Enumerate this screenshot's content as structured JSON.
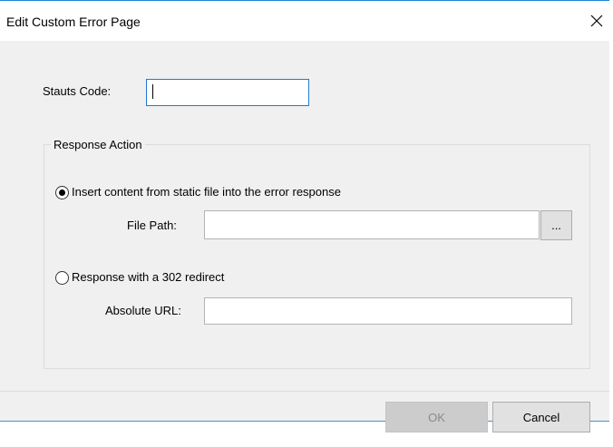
{
  "dialog": {
    "title": "Edit Custom Error Page",
    "close_icon": "close-icon"
  },
  "status_code": {
    "label": "Stauts Code:",
    "value": ""
  },
  "response_action": {
    "legend": "Response Action",
    "option_static": {
      "label": "Insert content from static file into the error response",
      "selected": true
    },
    "file_path": {
      "label": "File Path:",
      "value": "",
      "browse_label": "..."
    },
    "option_redirect": {
      "label": "Response with a 302 redirect",
      "selected": false
    },
    "absolute_url": {
      "label": "Absolute URL:",
      "value": ""
    }
  },
  "buttons": {
    "ok_label": "OK",
    "ok_enabled": false,
    "cancel_label": "Cancel"
  }
}
